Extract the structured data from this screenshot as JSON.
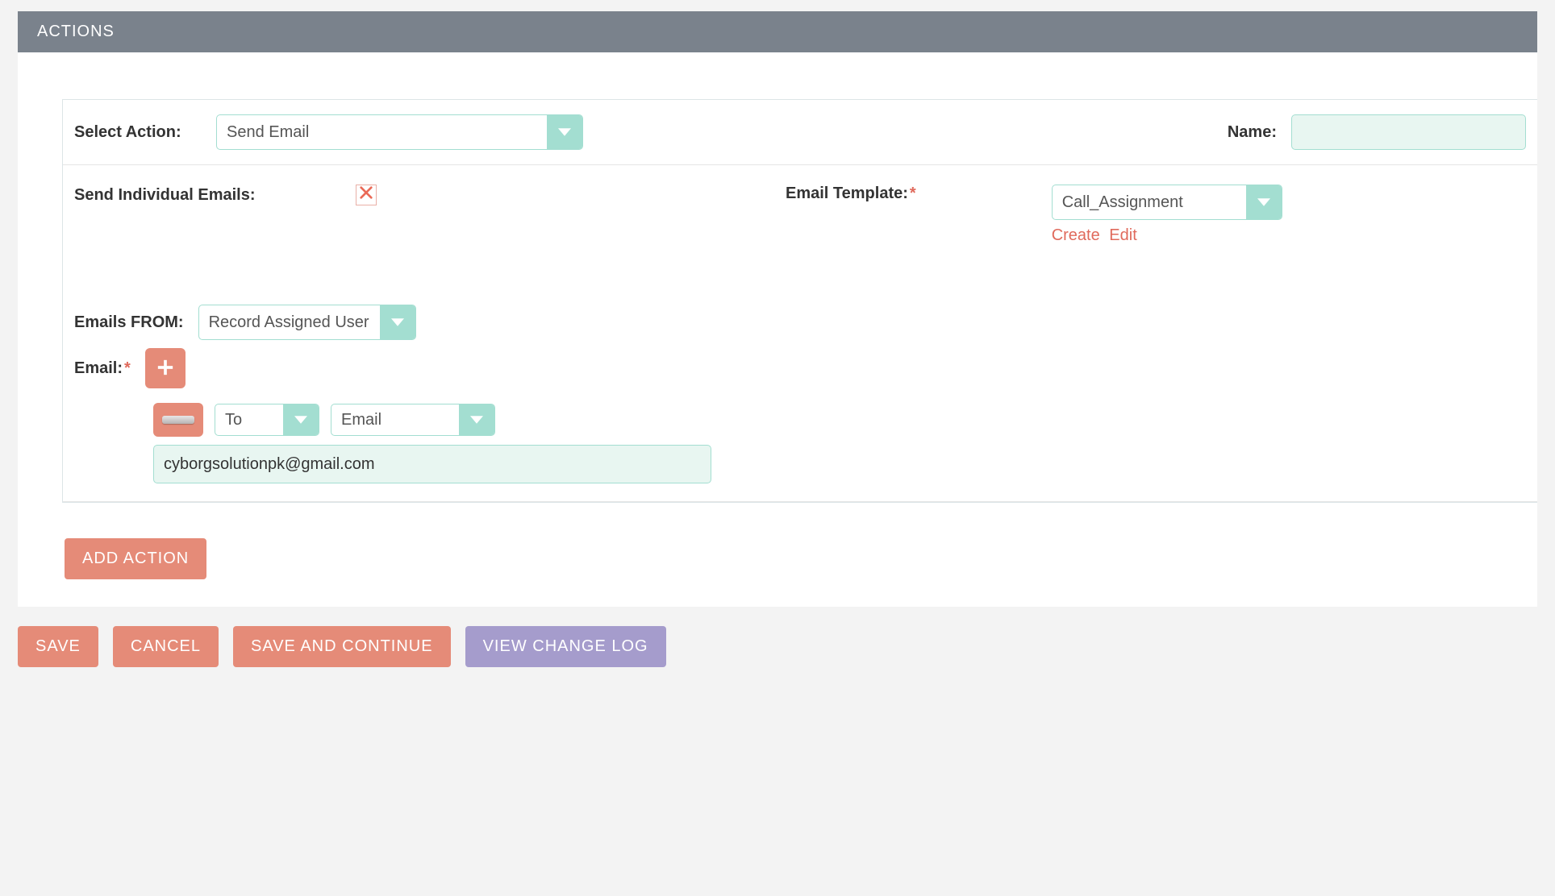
{
  "header": {
    "title": "ACTIONS"
  },
  "labels": {
    "select_action": "Select Action:",
    "name": "Name:",
    "send_individual": "Send Individual Emails:",
    "email_template": "Email Template:",
    "emails_from": "Emails FROM:",
    "email": "Email:"
  },
  "selects": {
    "action": "Send Email",
    "template": "Call_Assignment",
    "from": "Record Assigned User",
    "recipient_type": "To",
    "recipient_field": "Email"
  },
  "inputs": {
    "name_value": "",
    "email_value": "cyborgsolutionpk@gmail.com"
  },
  "links": {
    "create": "Create",
    "edit": "Edit"
  },
  "buttons": {
    "add_action": "ADD ACTION",
    "save": "SAVE",
    "cancel": "CANCEL",
    "save_continue": "SAVE AND CONTINUE",
    "view_log": "VIEW CHANGE LOG"
  }
}
